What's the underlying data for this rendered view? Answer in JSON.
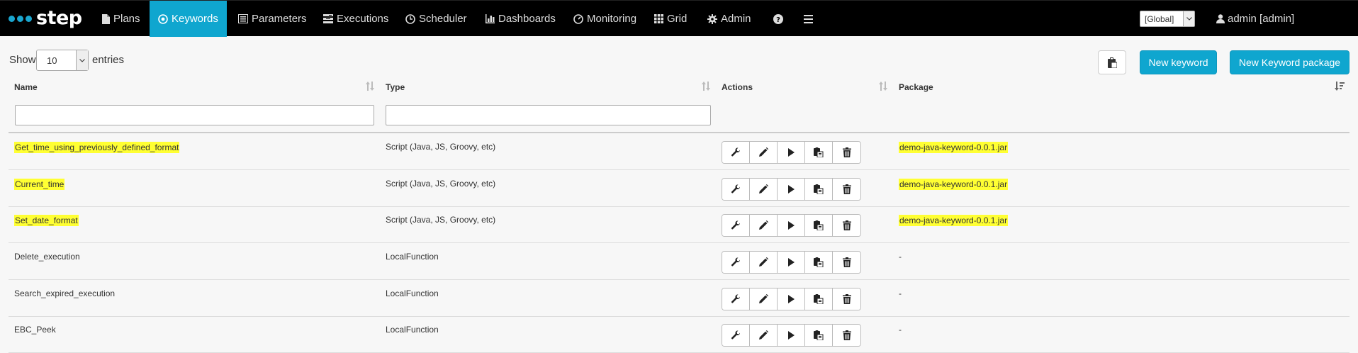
{
  "app": {
    "brand": "step",
    "nav": [
      {
        "label": "Plans",
        "icon": "document-icon"
      },
      {
        "label": "Keywords",
        "icon": "target-icon",
        "active": true
      },
      {
        "label": "Parameters",
        "icon": "list-icon"
      },
      {
        "label": "Executions",
        "icon": "tasks-icon"
      },
      {
        "label": "Scheduler",
        "icon": "clock-icon"
      },
      {
        "label": "Dashboards",
        "icon": "bar-chart-icon"
      },
      {
        "label": "Monitoring",
        "icon": "gauge-icon"
      },
      {
        "label": "Grid",
        "icon": "grid-icon"
      },
      {
        "label": "Admin",
        "icon": "gear-icon"
      }
    ],
    "scope": "[Global]",
    "user": "admin [admin]",
    "accent_color": "#0fa6cf"
  },
  "toolbar": {
    "show_label": "Show",
    "page_size": "10",
    "entries_label": "entries",
    "new_keyword_label": "New keyword",
    "new_package_label": "New Keyword package"
  },
  "table": {
    "columns": [
      "Name",
      "Type",
      "Actions",
      "Package"
    ],
    "rows": [
      {
        "name": "Get_time_using_previously_defined_format",
        "type": "Script (Java, JS, Groovy, etc)",
        "package": "demo-java-keyword-0.0.1.jar",
        "highlighted": true
      },
      {
        "name": "Current_time",
        "type": "Script (Java, JS, Groovy, etc)",
        "package": "demo-java-keyword-0.0.1.jar",
        "highlighted": true
      },
      {
        "name": "Set_date_format",
        "type": "Script (Java, JS, Groovy, etc)",
        "package": "demo-java-keyword-0.0.1.jar",
        "highlighted": true
      },
      {
        "name": "Delete_execution",
        "type": "LocalFunction",
        "package": "-",
        "highlighted": false
      },
      {
        "name": "Search_expired_execution",
        "type": "LocalFunction",
        "package": "-",
        "highlighted": false
      },
      {
        "name": "EBC_Peek",
        "type": "LocalFunction",
        "package": "-",
        "highlighted": false
      }
    ],
    "row_actions": [
      "wrench-icon",
      "pencil-icon",
      "play-icon",
      "copy-icon",
      "trash-icon"
    ]
  }
}
